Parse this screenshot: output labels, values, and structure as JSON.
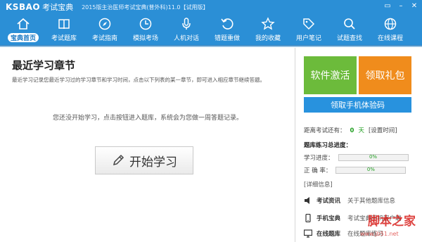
{
  "titlebar": {
    "logo": "KSBAO",
    "logo_sub": "考试宝典",
    "window_title": "2015版主治医师考试宝典(普外科)11.0【试用版】"
  },
  "nav": {
    "items": [
      {
        "label": "宝典首页",
        "icon": "home-icon"
      },
      {
        "label": "考试题库",
        "icon": "book-icon"
      },
      {
        "label": "考试指南",
        "icon": "compass-icon"
      },
      {
        "label": "模拟考场",
        "icon": "clock-icon"
      },
      {
        "label": "人机对话",
        "icon": "mic-icon"
      },
      {
        "label": "错题重做",
        "icon": "undo-icon"
      },
      {
        "label": "我的收藏",
        "icon": "star-icon"
      },
      {
        "label": "用户笔记",
        "icon": "tag-icon"
      },
      {
        "label": "试题查找",
        "icon": "search-icon"
      },
      {
        "label": "在线课程",
        "icon": "globe-icon"
      }
    ]
  },
  "main": {
    "title": "最近学习章节",
    "description": "最近学习记录您最近学习过的学习章节和学习时间，点击以下列表的某一章节，即可进入相应章节继续答题。",
    "empty_message": "您还没开始学习，点击按钮进入题库，系统会为您做一周答题记录。",
    "start_button": "开始学习"
  },
  "side": {
    "activate": "软件激活",
    "gift": "领取礼包",
    "trial": "领取手机体验码",
    "countdown_label": "距离考试还有：",
    "countdown_value": "0",
    "countdown_unit": "天",
    "set_time": "[设置时间]",
    "stats_title": "题库练习总进度：",
    "progress_label": "学习进度：",
    "progress_value": "0%",
    "accuracy_label": "正 确 率：",
    "accuracy_value": "0%",
    "detail": "[详细信息]",
    "rows": [
      {
        "label": "考试资讯",
        "value": "关于其他题库信息",
        "icon": "speaker-icon"
      },
      {
        "label": "手机宝典",
        "value": "考试宝典手机客户端",
        "icon": "phone-icon"
      },
      {
        "label": "在线题库",
        "value": "在线题库练习",
        "icon": "monitor-icon"
      }
    ]
  },
  "watermark": {
    "text": "脚本之家",
    "url": "www.jb51.net"
  },
  "colors": {
    "primary": "#2b8fd6",
    "green": "#6cbb3b",
    "orange": "#f08c1c",
    "blue_button": "#2892de"
  }
}
